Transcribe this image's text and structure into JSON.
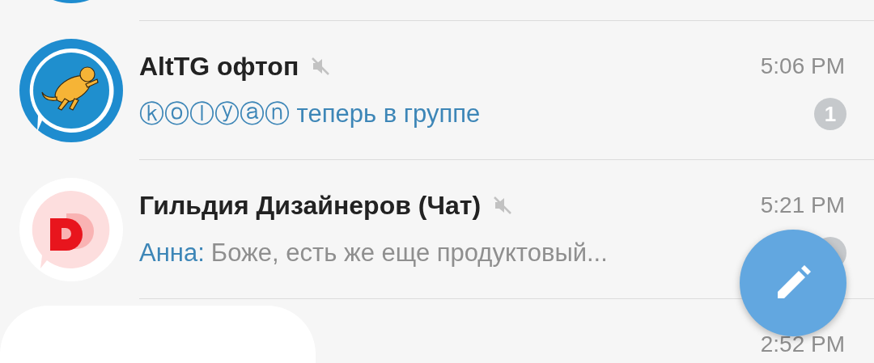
{
  "chats": [
    {
      "kind": "cut-off",
      "avatar": {
        "kind": "plain"
      }
    },
    {
      "kind": "chat",
      "avatar": {
        "kind": "cat"
      },
      "title": "AltTG офтоп",
      "muted": true,
      "time": "5:06 PM",
      "preview": {
        "kind": "service",
        "text": "ⓚⓞⓛⓨⓐⓝ теперь в группе"
      },
      "unread": true,
      "count": "1"
    },
    {
      "kind": "chat",
      "avatar": {
        "kind": "letter-logo"
      },
      "title": "Гильдия Дизайнеров (Чат)",
      "muted": true,
      "time": "5:21 PM",
      "preview": {
        "kind": "message",
        "sender": "Анна:",
        "text": "Боже, есть же еще продуктовый..."
      },
      "unread": true
    },
    {
      "kind": "redacted",
      "time": "2:52 PM"
    }
  ],
  "compose_button": {
    "visible": true
  }
}
